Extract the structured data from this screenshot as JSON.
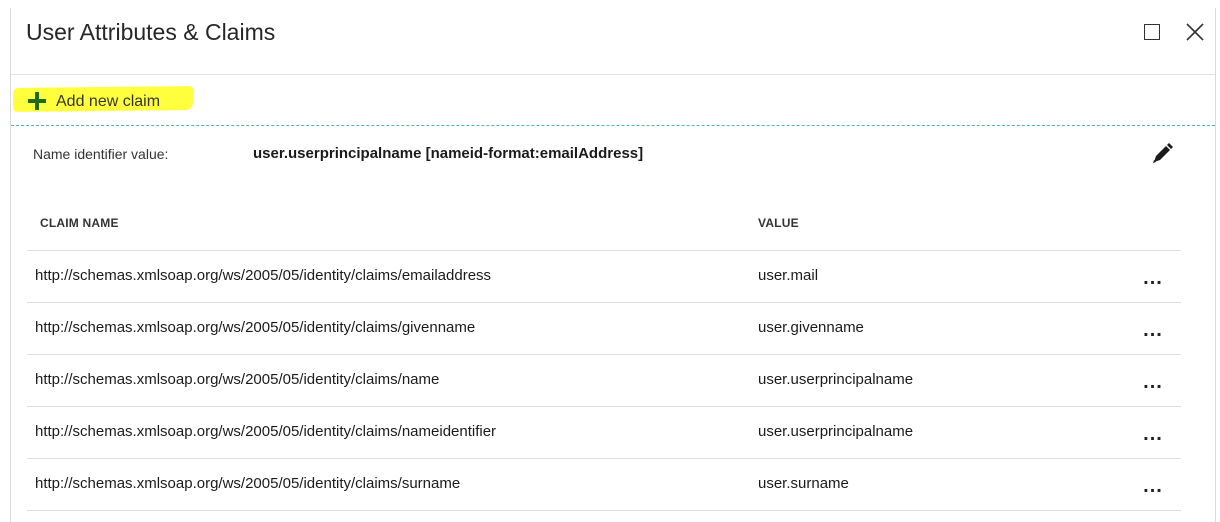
{
  "header": {
    "title": "User Attributes & Claims",
    "maximize_icon": "maximize-icon",
    "close_icon": "close-icon"
  },
  "toolbar": {
    "add_label": "Add new claim",
    "add_icon": "plus-icon",
    "plus_color": "#1e6b1e",
    "highlight_color": "#ffff2e"
  },
  "name_identifier": {
    "label": "Name identifier value:",
    "value": "user.userprincipalname [nameid-format:emailAddress]",
    "edit_icon": "pencil-icon"
  },
  "table": {
    "columns": [
      "CLAIM NAME",
      "VALUE"
    ],
    "rows": [
      {
        "name": "http://schemas.xmlsoap.org/ws/2005/05/identity/claims/emailaddress",
        "value": "user.mail",
        "menu": "..."
      },
      {
        "name": "http://schemas.xmlsoap.org/ws/2005/05/identity/claims/givenname",
        "value": "user.givenname",
        "menu": "..."
      },
      {
        "name": "http://schemas.xmlsoap.org/ws/2005/05/identity/claims/name",
        "value": "user.userprincipalname",
        "menu": "..."
      },
      {
        "name": "http://schemas.xmlsoap.org/ws/2005/05/identity/claims/nameidentifier",
        "value": "user.userprincipalname",
        "menu": "..."
      },
      {
        "name": "http://schemas.xmlsoap.org/ws/2005/05/identity/claims/surname",
        "value": "user.surname",
        "menu": "..."
      }
    ]
  }
}
